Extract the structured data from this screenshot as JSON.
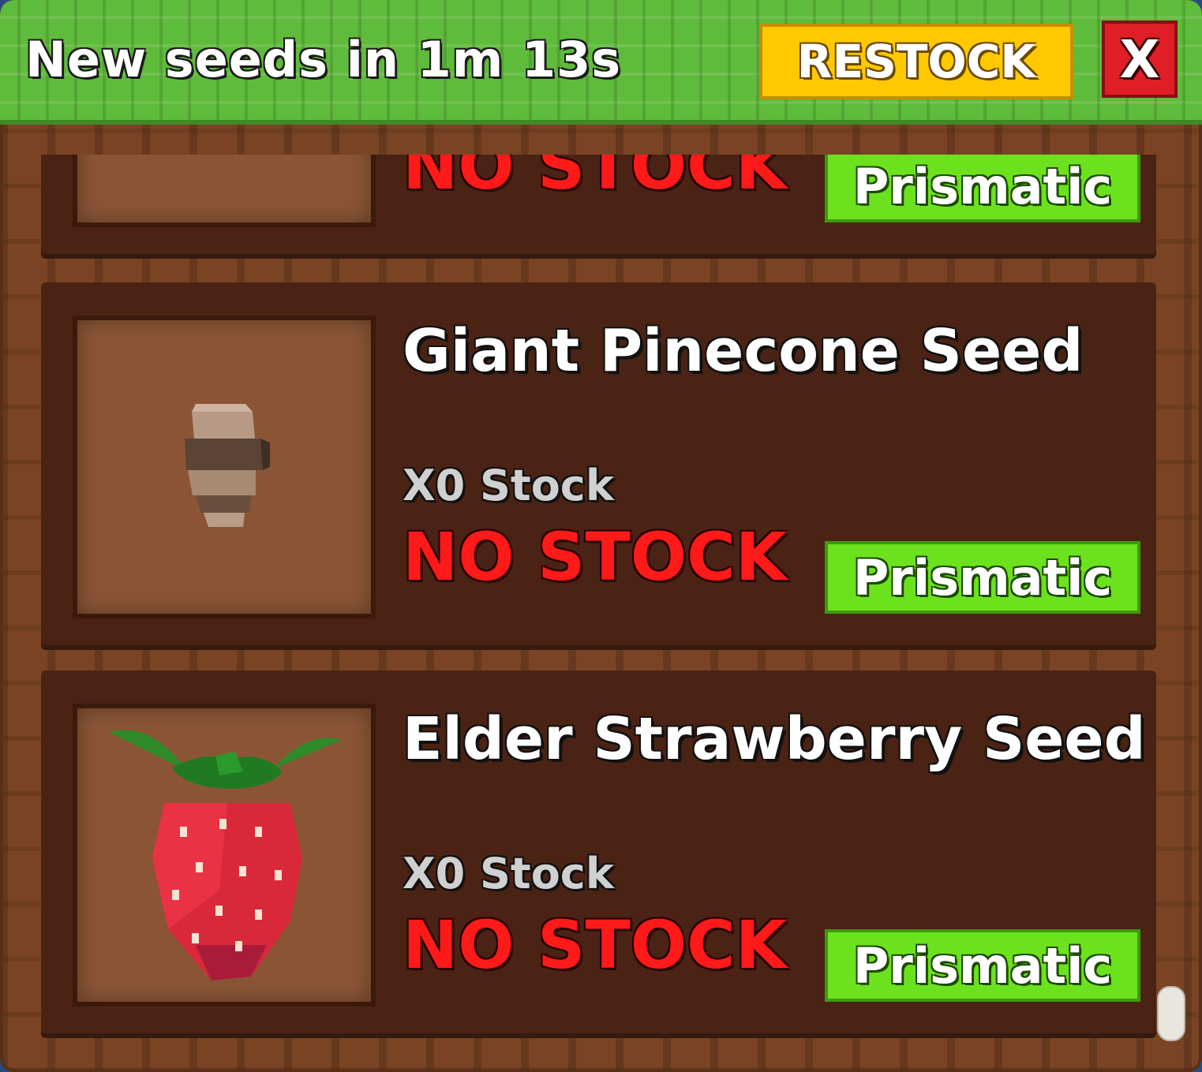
{
  "header": {
    "timer_text": "New seeds in 1m 13s",
    "restock_label": "RESTOCK",
    "close_label": "X"
  },
  "items": [
    {
      "name": "",
      "stock_count": "",
      "status": "NO STOCK",
      "rarity": "Prismatic",
      "icon": "none"
    },
    {
      "name": "Giant Pinecone Seed",
      "stock_count": "X0 Stock",
      "status": "NO STOCK",
      "rarity": "Prismatic",
      "icon": "pinecone-icon"
    },
    {
      "name": "Elder Strawberry Seed",
      "stock_count": "X0 Stock",
      "status": "NO STOCK",
      "rarity": "Prismatic",
      "icon": "strawberry-icon"
    }
  ],
  "colors": {
    "header_green": "#5fbb3b",
    "restock_yellow": "#ffc800",
    "close_red": "#e01e26",
    "no_stock_red": "#ff1a1a",
    "rarity_green": "#6ce21e",
    "card_brown": "#4a2314"
  }
}
